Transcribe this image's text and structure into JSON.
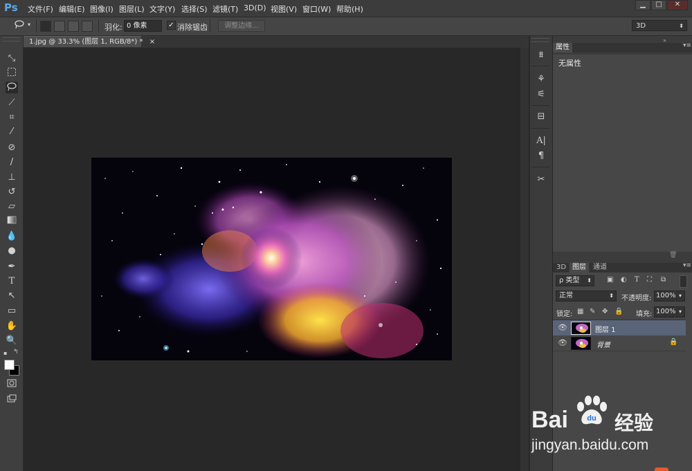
{
  "app": {
    "logo": "Ps"
  },
  "menubar": {
    "items": [
      "文件(F)",
      "编辑(E)",
      "图像(I)",
      "图层(L)",
      "文字(Y)",
      "选择(S)",
      "滤镜(T)",
      "3D(D)",
      "视图(V)",
      "窗口(W)",
      "帮助(H)"
    ],
    "window_controls": [
      "▁",
      "□",
      "✕"
    ]
  },
  "options_bar": {
    "tool_icon": "lasso-icon",
    "feather_label": "羽化:",
    "feather_value": "0 像素",
    "antialias_checked": true,
    "antialias_label": "消除锯齿",
    "refine_edge_label": "调整边缘...",
    "workspace_value": "3D"
  },
  "toolbox": {
    "tools": [
      "move-tool-icon",
      "marquee-tool-icon",
      "lasso-tool-icon",
      "quick-select-tool-icon",
      "crop-tool-icon",
      "eyedropper-tool-icon",
      "healing-brush-tool-icon",
      "brush-tool-icon",
      "clone-stamp-tool-icon",
      "history-brush-tool-icon",
      "eraser-tool-icon",
      "gradient-tool-icon",
      "blur-tool-icon",
      "dodge-tool-icon",
      "pen-tool-icon",
      "type-tool-icon",
      "path-select-tool-icon",
      "rectangle-tool-icon",
      "hand-tool-icon",
      "zoom-tool-icon"
    ],
    "selected": "lasso-tool-icon",
    "foreground_color": "#ffffff",
    "background_color": "#000000"
  },
  "document": {
    "tab_title": "1.jpg @ 33.3% (图层 1, RGB/8*) *",
    "close_glyph": "×"
  },
  "properties_panel": {
    "tab": "属性",
    "body_text": "无属性"
  },
  "layers_panel": {
    "tabs": [
      "3D",
      "图层",
      "通道"
    ],
    "active_tab": "图层",
    "filter_kind": "ρ 类型",
    "blend_mode": "正常",
    "opacity_label": "不透明度:",
    "opacity_value": "100%",
    "lock_label": "锁定:",
    "fill_label": "填充:",
    "fill_value": "100%",
    "layers": [
      {
        "name": "图层 1",
        "selected": true,
        "locked": false
      },
      {
        "name": "背景",
        "selected": false,
        "locked": true
      }
    ]
  },
  "watermark": {
    "brand": "Bai",
    "brand2": "经验",
    "url": "jingyan.baidu.com"
  }
}
